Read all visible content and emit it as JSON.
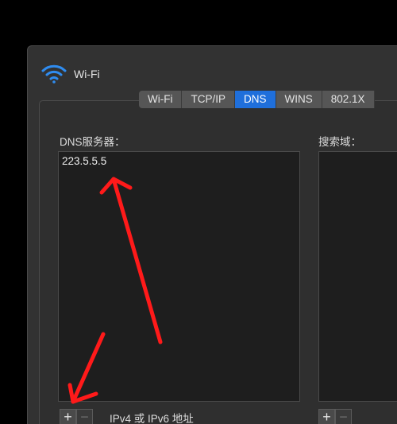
{
  "window": {
    "title": "Wi-Fi",
    "icon": "wifi-icon"
  },
  "tabs": [
    {
      "label": "Wi-Fi",
      "active": false
    },
    {
      "label": "TCP/IP",
      "active": false
    },
    {
      "label": "DNS",
      "active": true
    },
    {
      "label": "WINS",
      "active": false
    },
    {
      "label": "802.1X",
      "active": false
    }
  ],
  "dns": {
    "label": "DNS服务器：",
    "servers": [
      "223.5.5.5"
    ],
    "add_label": "+",
    "remove_label": "−",
    "hint": "IPv4 或 IPv6 地址"
  },
  "search": {
    "label": "搜索域：",
    "add_label": "+",
    "remove_label": "−"
  },
  "colors": {
    "accent": "#1f6fdb",
    "annotation_arrow": "#ff1a1a"
  }
}
